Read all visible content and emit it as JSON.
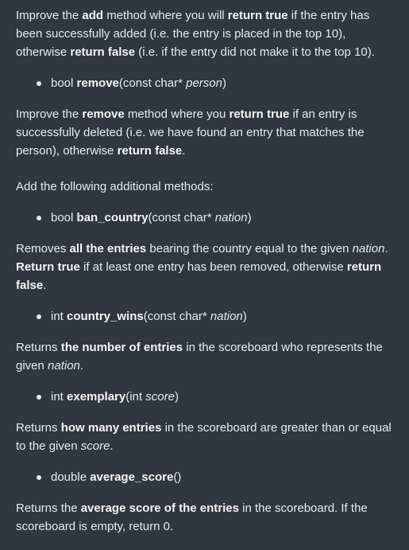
{
  "p1": {
    "t1": "Improve the ",
    "b1": "add",
    "t2": " method where you will ",
    "b2": "return true",
    "t3": " if the entry has been successfully added (i.e. the entry is placed in the top 10), otherwise ",
    "b3": "return false",
    "t4": " (i.e. if the entry did not make it to the top 10)."
  },
  "bullet1": {
    "t1": "bool ",
    "b1": "remove",
    "t2": "(const char* ",
    "i1": "person",
    "t3": ")"
  },
  "p2": {
    "t1": "Improve the ",
    "b1": "remove",
    "t2": " method where you ",
    "b2": "return true",
    "t3": " if an entry is successfully deleted (i.e. we have found an entry that matches the person), otherwise ",
    "b3": "return false",
    "t4": "."
  },
  "p3": {
    "t1": "Add the following additional methods:"
  },
  "bullet2": {
    "t1": "bool ",
    "b1": "ban_country",
    "t2": "(const char* ",
    "i1": "nation",
    "t3": ")"
  },
  "p4": {
    "t1": "Removes ",
    "b1": "all the entries",
    "t2": " bearing the country equal to the given ",
    "i1": "nation",
    "t3": ". ",
    "b2": "Return true",
    "t4": " if at least one entry has been removed, otherwise ",
    "b3": "return false",
    "t5": "."
  },
  "bullet3": {
    "t1": "int ",
    "b1": "country_wins",
    "t2": "(const char* ",
    "i1": "nation",
    "t3": ")"
  },
  "p5": {
    "t1": "Returns ",
    "b1": "the number of entries",
    "t2": " in the scoreboard who represents the given ",
    "i1": "nation",
    "t3": "."
  },
  "bullet4": {
    "t1": "int ",
    "b1": "exemplary",
    "t2": "(int ",
    "i1": "score",
    "t3": ")"
  },
  "p6": {
    "t1": "Returns ",
    "b1": "how many entries",
    "t2": " in the scoreboard are greater than or equal to the given ",
    "i1": "score",
    "t3": "."
  },
  "bullet5": {
    "t1": "double ",
    "b1": "average_score",
    "t2": "()"
  },
  "p7": {
    "t1": "Returns the ",
    "b1": "average score of the entries",
    "t2": " in the scoreboard. If the scoreboard is empty, return 0."
  }
}
